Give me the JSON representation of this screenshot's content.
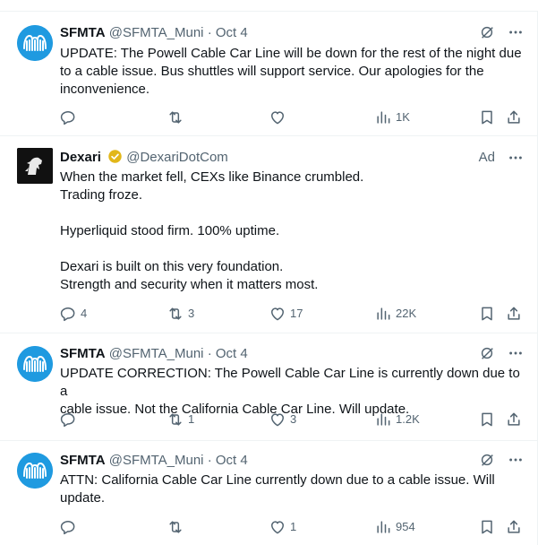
{
  "tweets": [
    {
      "author_name": "SFMTA",
      "handle": "@SFMTA_Muni",
      "dot": "·",
      "date": "Oct 4",
      "lines": [
        "UPDATE: The Powell Cable Car Line will be down for the rest of the night due",
        "to a cable issue. Bus shuttles will support service. Our apologies for the",
        "inconvenience."
      ],
      "replies": "",
      "reposts": "",
      "likes": "",
      "views": "1K"
    },
    {
      "author_name": "Dexari",
      "handle": "@DexariDotCom",
      "ad_label": "Ad",
      "lines": [
        "When the market fell, CEXs like Binance crumbled.",
        "Trading froze.",
        "",
        "Hyperliquid stood firm. 100% uptime.",
        "",
        "Dexari is built on this very foundation.",
        "Strength and security when it matters most."
      ],
      "replies": "4",
      "reposts": "3",
      "likes": "17",
      "views": "22K"
    },
    {
      "author_name": "SFMTA",
      "handle": "@SFMTA_Muni",
      "dot": "·",
      "date": "Oct 4",
      "lines": [
        "UPDATE CORRECTION: The Powell Cable Car Line is currently down due to a",
        "cable issue. Not the California Cable Car Line. Will update."
      ],
      "replies": "",
      "reposts": "1",
      "likes": "3",
      "views": "1.2K"
    },
    {
      "author_name": "SFMTA",
      "handle": "@SFMTA_Muni",
      "dot": "·",
      "date": "Oct 4",
      "lines": [
        "ATTN: California Cable Car Line currently down due to a cable issue. Will",
        "update."
      ],
      "replies": "",
      "reposts": "",
      "likes": "1",
      "views": "954"
    }
  ],
  "colors": {
    "text": "#0f1419",
    "muted": "#536471",
    "divider": "#eff3f4",
    "sfmta_avatar": "#1f9ae0",
    "verified_gold": "#e2b719"
  }
}
